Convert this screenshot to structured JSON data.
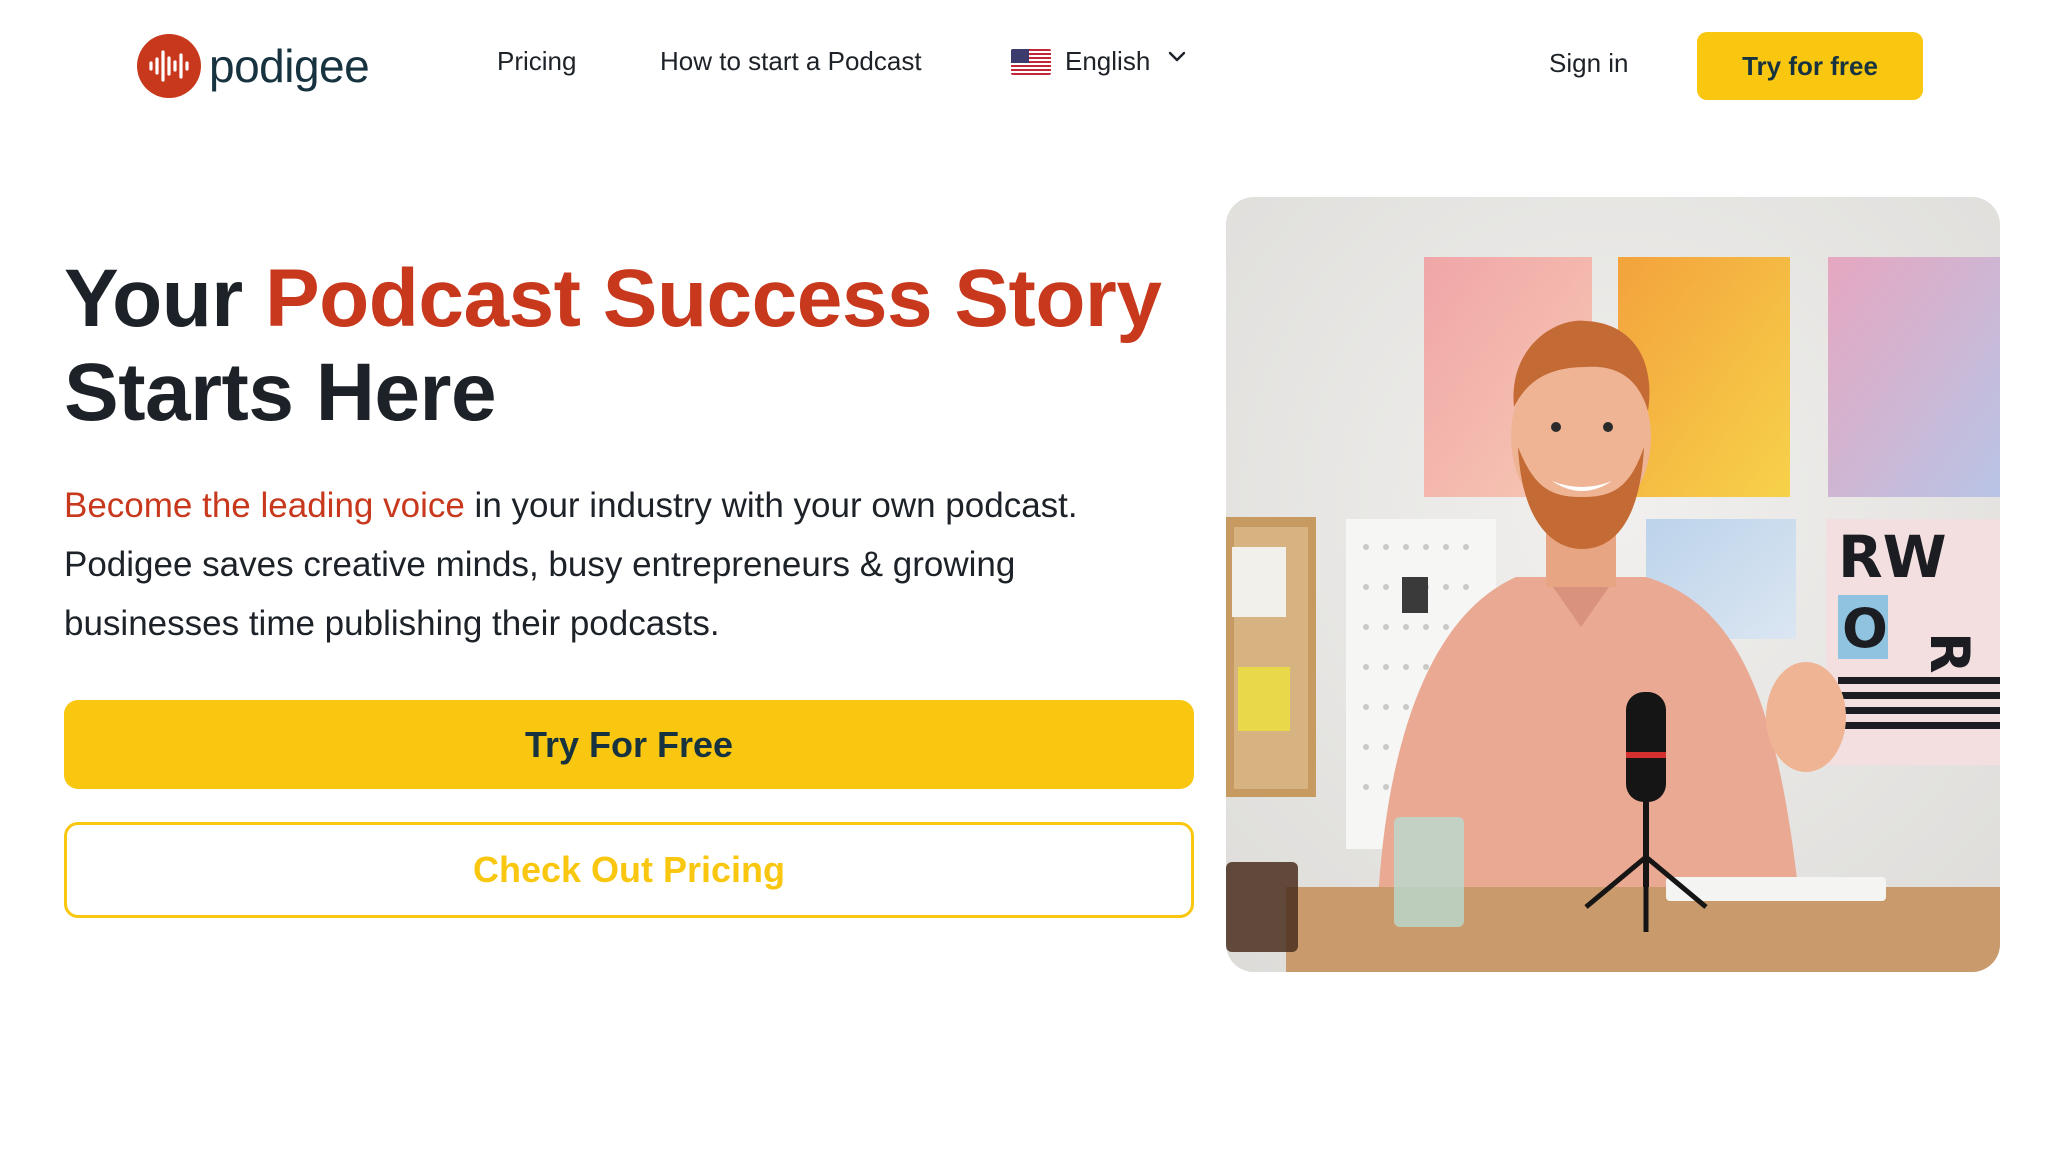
{
  "brand": {
    "name": "podigee",
    "logo_icon": "soundwave-logo-icon"
  },
  "nav": {
    "pricing": "Pricing",
    "how_to": "How to start a Podcast",
    "language": "English",
    "language_flag": "us-flag-icon",
    "sign_in": "Sign in",
    "cta": "Try for free"
  },
  "hero": {
    "headline_part1": "Your ",
    "headline_accent": "Podcast Success Story",
    "headline_part2": "Starts Here",
    "lead_accent": "Become the leading voice",
    "lead_rest": " in your industry with your own podcast. Podigee saves creative minds, busy entrepreneurs & growing businesses time publishing their podcasts.",
    "primary_button": "Try For Free",
    "secondary_button": "Check Out Pricing",
    "photo_poster_text": "RW O R"
  },
  "colors": {
    "brand_red": "#c8381d",
    "brand_yellow": "#f9c70f",
    "text_dark": "#1d2228",
    "logo_text": "#17333f"
  }
}
